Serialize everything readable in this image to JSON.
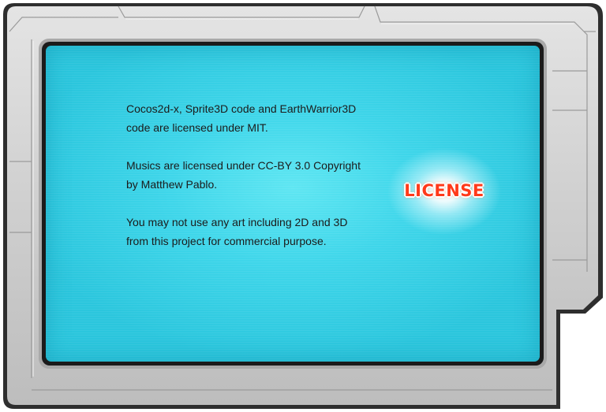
{
  "license_panel": {
    "title": "LICENSE",
    "paragraphs": [
      "Cocos2d-x, Sprite3D code and EarthWarrior3D code are licensed under MIT.",
      "Musics are licensed under CC-BY 3.0 Copyright by Matthew Pablo.",
      "You may not use any art including 2D and 3D from this project for commercial purpose."
    ]
  },
  "colors": {
    "screen": "#3fd6ea",
    "frame": "#c8c8c8",
    "frame_outline": "#3a3a3a",
    "title": "#ff3a1a",
    "text": "#1b1b1b"
  }
}
